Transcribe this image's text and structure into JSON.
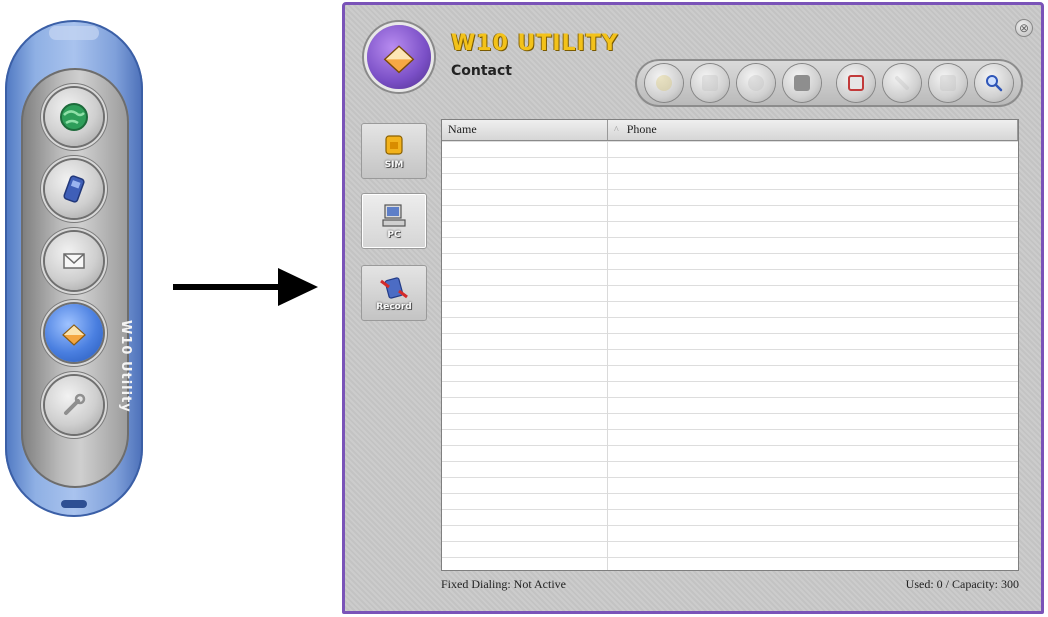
{
  "launcher": {
    "label": "W10 Utility",
    "buttons": [
      {
        "name": "globe-icon"
      },
      {
        "name": "phone-icon"
      },
      {
        "name": "envelope-icon"
      },
      {
        "name": "contact-book-icon",
        "active": true
      },
      {
        "name": "wrench-icon"
      }
    ]
  },
  "window": {
    "app_title": "W10 UTILITY",
    "section_title": "Contact",
    "close_glyph": "⊗",
    "toolbar": [
      {
        "name": "toolbar-button-1",
        "icon": "new-icon",
        "enabled": false,
        "color": "#d8c36a"
      },
      {
        "name": "toolbar-button-2",
        "icon": "document-icon",
        "enabled": false,
        "color": "#bdbdbd"
      },
      {
        "name": "toolbar-button-3",
        "icon": "message-icon",
        "enabled": false,
        "color": "#bdbdbd"
      },
      {
        "name": "toolbar-button-4",
        "icon": "copy-icon",
        "enabled": true,
        "color": "#8e8e8e"
      },
      {
        "name": "toolbar-button-5",
        "icon": "add-contact-icon",
        "enabled": true,
        "color": "#c23a3a"
      },
      {
        "name": "toolbar-button-6",
        "icon": "edit-icon",
        "enabled": false,
        "color": "#bdbdbd"
      },
      {
        "name": "toolbar-button-7",
        "icon": "delete-icon",
        "enabled": false,
        "color": "#bdbdbd"
      },
      {
        "name": "toolbar-button-8",
        "icon": "search-icon",
        "enabled": true,
        "color": "#3a62c4"
      }
    ],
    "side_tabs": [
      {
        "label": "SIM",
        "icon": "sim-card-icon",
        "selected": false
      },
      {
        "label": "PC",
        "icon": "computer-icon",
        "selected": true
      },
      {
        "label": "Record",
        "icon": "record-icon",
        "selected": false
      }
    ],
    "table": {
      "columns": [
        "Name",
        "Phone"
      ],
      "sort_glyph": "^",
      "rows": []
    },
    "status": {
      "fixed_dialing": "Fixed Dialing: Not Active",
      "capacity": "Used: 0 / Capacity: 300"
    }
  },
  "colors": {
    "window_border": "#7a53b8",
    "launcher_blue": "#4f78c2",
    "title_gold": "#f3c21a"
  }
}
